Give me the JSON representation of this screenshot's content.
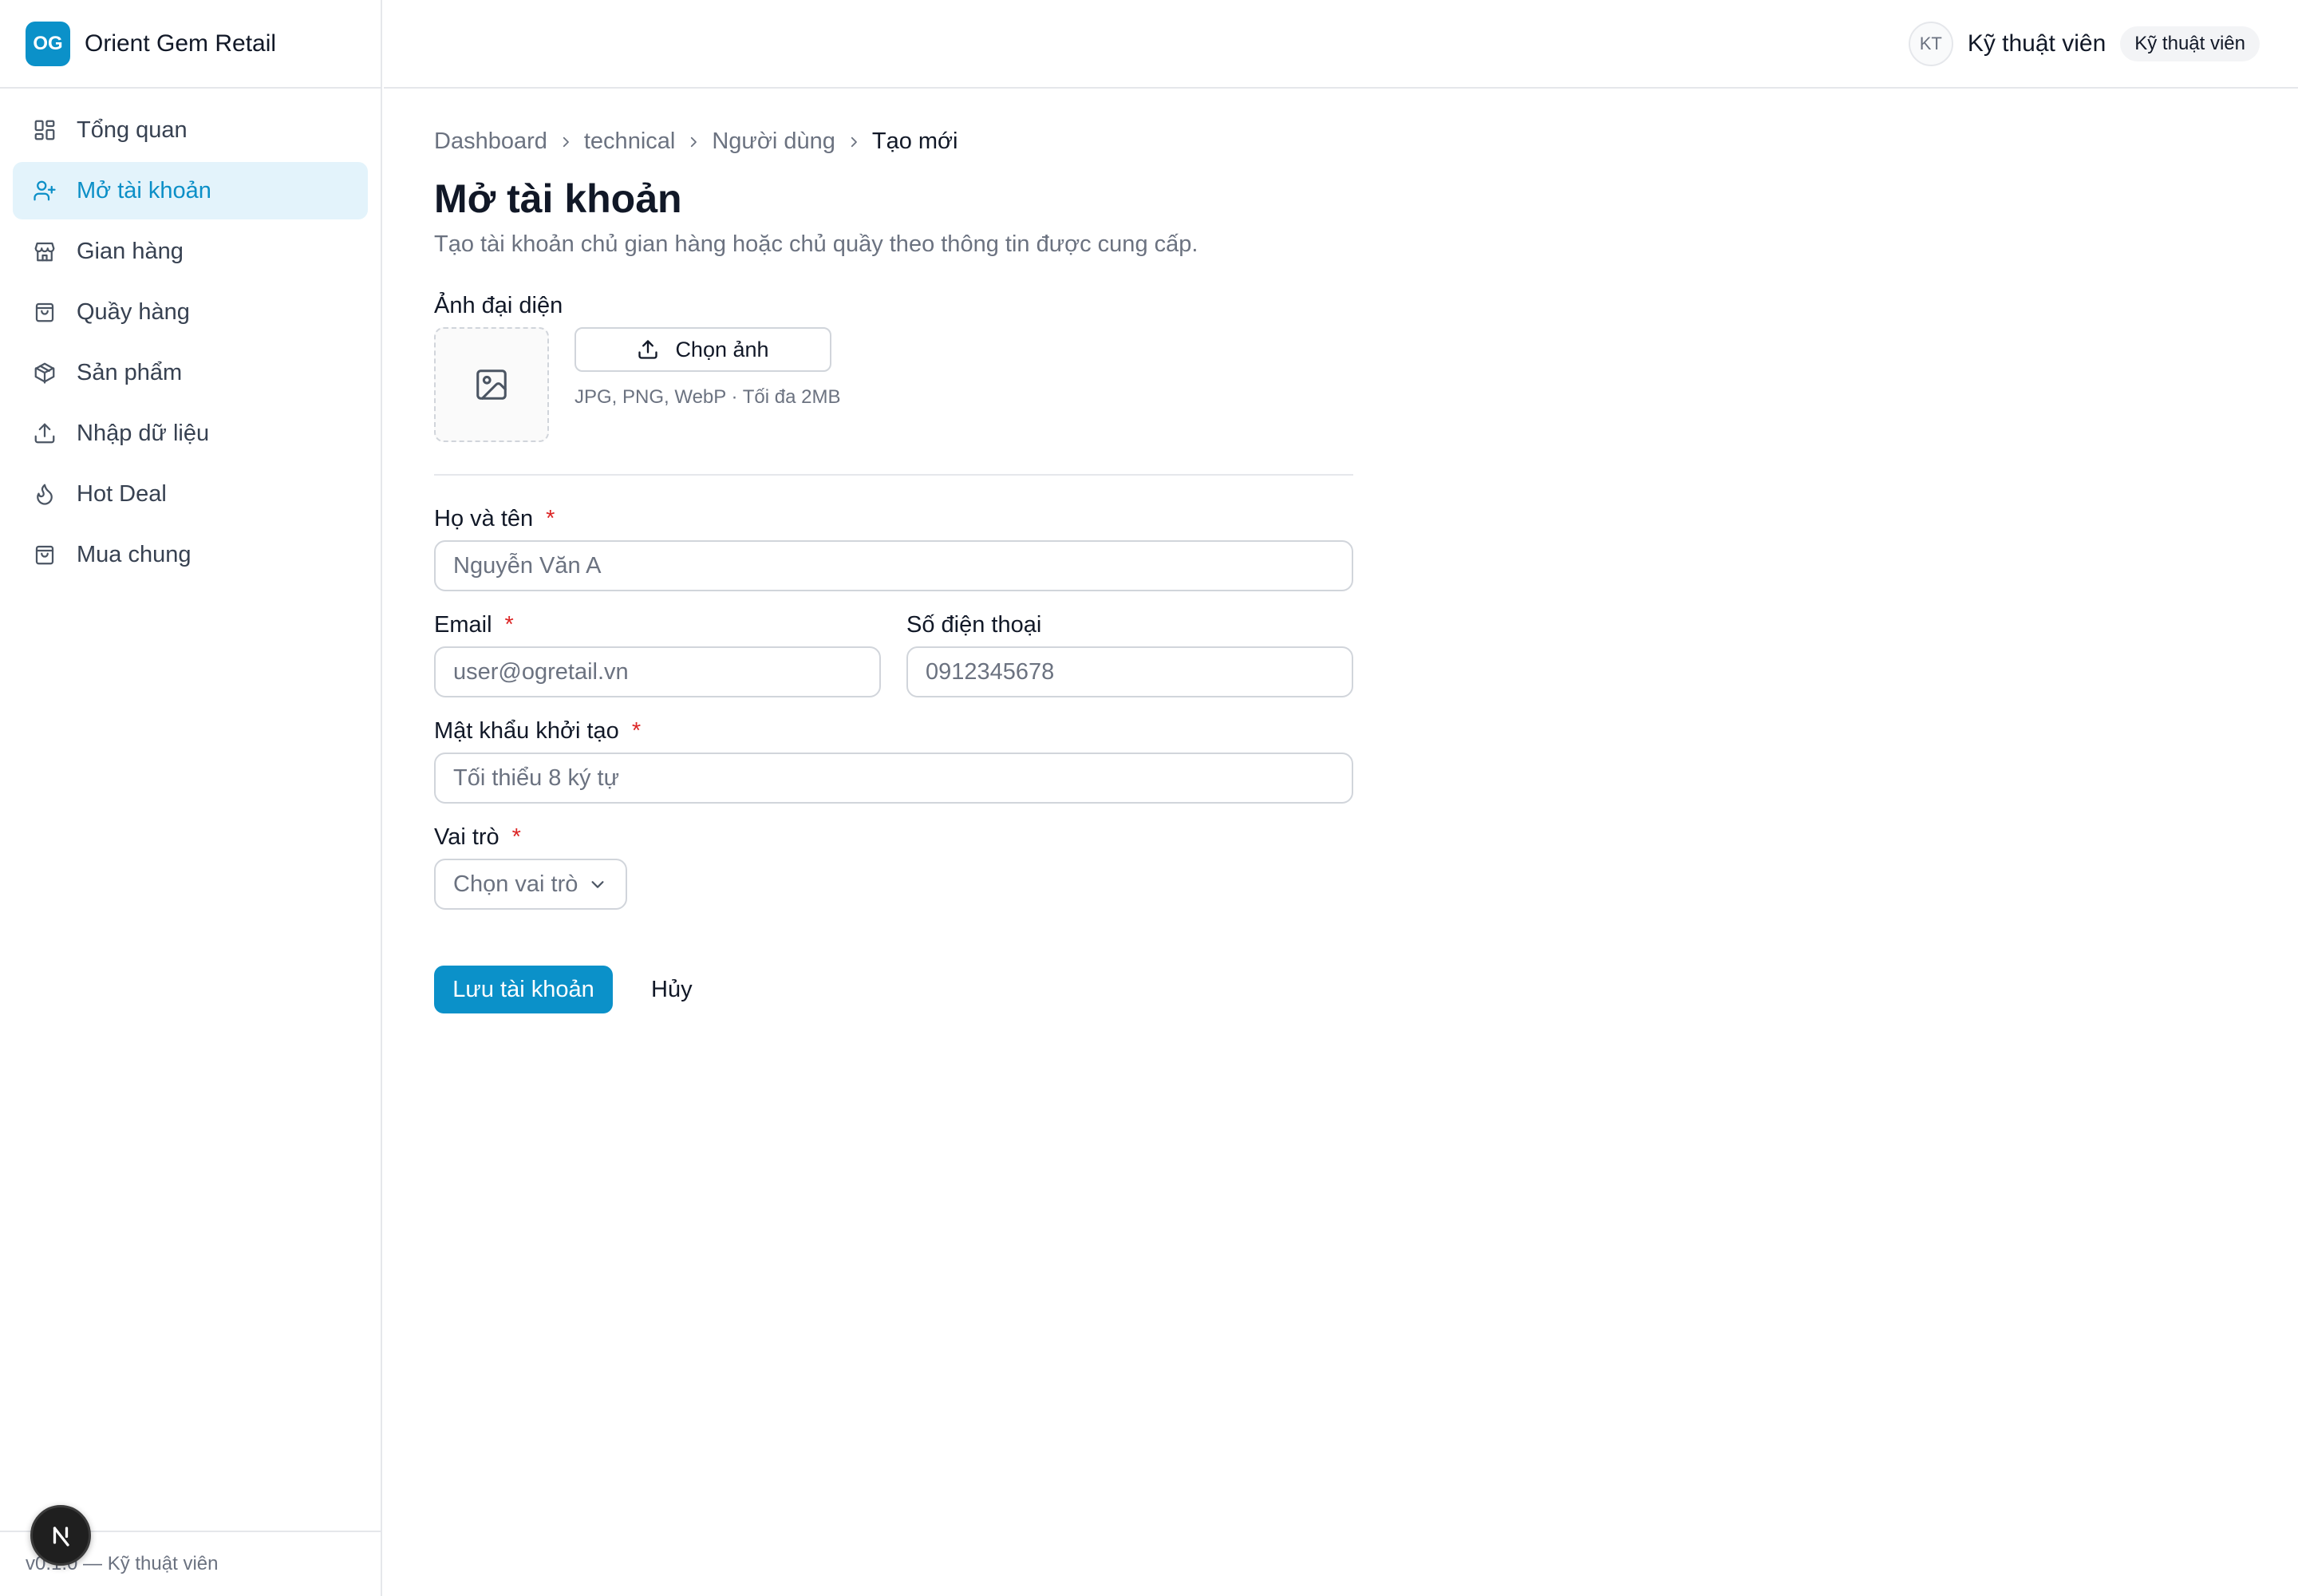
{
  "brand": {
    "logo_text": "OG",
    "name": "Orient Gem Retail"
  },
  "sidebar": {
    "items": [
      {
        "label": "Tổng quan",
        "icon": "dashboard-icon",
        "active": false
      },
      {
        "label": "Mở tài khoản",
        "icon": "user-plus-icon",
        "active": true
      },
      {
        "label": "Gian hàng",
        "icon": "store-icon",
        "active": false
      },
      {
        "label": "Quầy hàng",
        "icon": "shopping-bag-icon",
        "active": false
      },
      {
        "label": "Sản phẩm",
        "icon": "package-icon",
        "active": false
      },
      {
        "label": "Nhập dữ liệu",
        "icon": "upload-icon",
        "active": false
      },
      {
        "label": "Hot Deal",
        "icon": "flame-icon",
        "active": false
      },
      {
        "label": "Mua chung",
        "icon": "shopping-bag-icon",
        "active": false
      }
    ],
    "footer_text": "v0.1.0 — Kỹ thuật viên"
  },
  "header": {
    "avatar_initials": "KT",
    "user_name": "Kỹ thuật viên",
    "role_badge": "Kỹ thuật viên"
  },
  "breadcrumb": [
    "Dashboard",
    "technical",
    "Người dùng",
    "Tạo mới"
  ],
  "page": {
    "title": "Mở tài khoản",
    "subtitle": "Tạo tài khoản chủ gian hàng hoặc chủ quầy theo thông tin được cung cấp."
  },
  "form": {
    "avatar": {
      "label": "Ảnh đại diện",
      "button_label": "Chọn ảnh",
      "hint": "JPG, PNG, WebP · Tối đa 2MB"
    },
    "full_name": {
      "label": "Họ và tên",
      "required_mark": "*",
      "placeholder": "Nguyễn Văn A",
      "value": ""
    },
    "email": {
      "label": "Email",
      "required_mark": "*",
      "placeholder": "user@ogretail.vn",
      "value": ""
    },
    "phone": {
      "label": "Số điện thoại",
      "placeholder": "0912345678",
      "value": ""
    },
    "password": {
      "label": "Mật khẩu khởi tạo",
      "required_mark": "*",
      "placeholder": "Tối thiểu 8 ký tự",
      "value": ""
    },
    "role": {
      "label": "Vai trò",
      "required_mark": "*",
      "selected": "Chọn vai trò"
    },
    "submit_label": "Lưu tài khoản",
    "cancel_label": "Hủy"
  },
  "colors": {
    "accent": "#0b91c9",
    "active_bg": "#e3f3fb",
    "required": "#dc2626",
    "border": "#e5e7eb"
  }
}
